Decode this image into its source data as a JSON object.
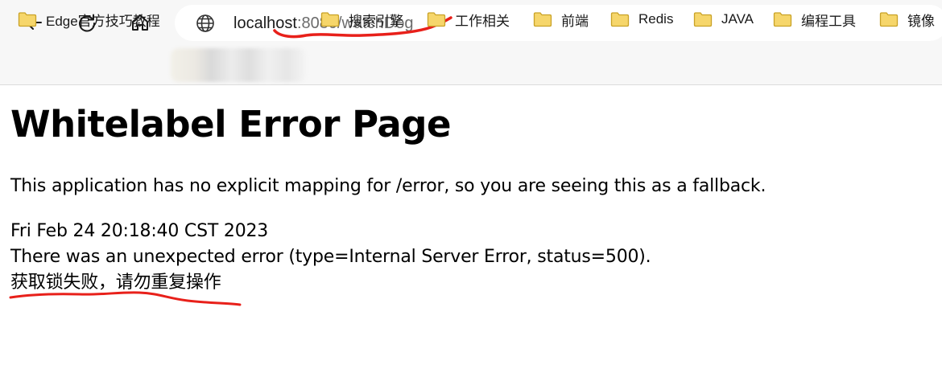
{
  "browser": {
    "address": {
      "host": "localhost",
      "rest": ":8080/watchDog"
    },
    "bookmarks": [
      {
        "label": "Edge官方技巧教程"
      },
      {
        "label": "搜索引擎"
      },
      {
        "label": "工作相关"
      },
      {
        "label": "前端"
      },
      {
        "label": "Redis"
      },
      {
        "label": "JAVA"
      },
      {
        "label": "编程工具"
      },
      {
        "label": "镜像"
      }
    ]
  },
  "page": {
    "title": "Whitelabel Error Page",
    "description": "This application has no explicit mapping for /error, so you are seeing this as a fallback.",
    "timestamp": "Fri Feb 24 20:18:40 CST 2023",
    "error_line": "There was an unexpected error (type=Internal Server Error, status=500).",
    "message": "获取锁失败，请勿重复操作"
  },
  "colors": {
    "annotation": "#e8201a",
    "folder_fill": "#f6d66b",
    "folder_stroke": "#c9a227"
  }
}
